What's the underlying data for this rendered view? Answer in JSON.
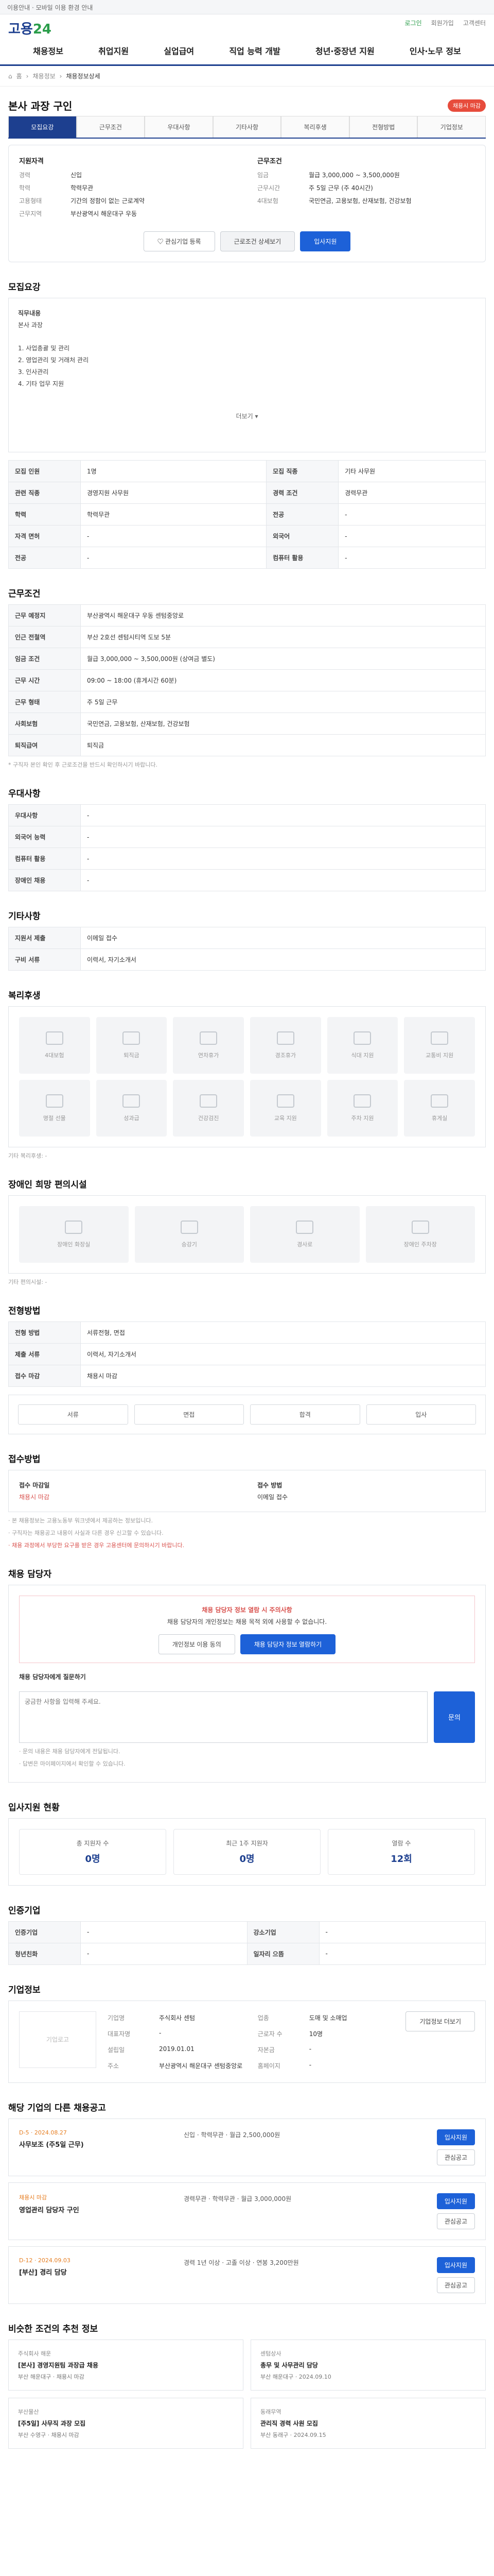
{
  "notice": "이용안내 · 모바일 이용 환경 안내",
  "top_links": [
    "로그인",
    "회원가입",
    "고객센터"
  ],
  "logo": {
    "main": "고용",
    "accent": "24"
  },
  "gnb": [
    "채용정보",
    "취업지원",
    "실업급여",
    "직업 능력 개발",
    "청년·중장년 지원",
    "인사·노무 정보"
  ],
  "breadcrumb": [
    "홈",
    "채용정보",
    "채용정보상세"
  ],
  "tabs": [
    "모집요강",
    "근무조건",
    "우대사항",
    "기타사항",
    "복리후생",
    "전형방법",
    "기업정보"
  ],
  "job": {
    "title": "본사 과장 구인",
    "deadline": "채용시 마감"
  },
  "summary": {
    "left_head": "지원자격",
    "left": [
      {
        "k": "경력",
        "v": "신입"
      },
      {
        "k": "학력",
        "v": "학력무관"
      },
      {
        "k": "고용형태",
        "v": "기간의 정함이 없는 근로계약"
      },
      {
        "k": "근무지역",
        "v": "부산광역시 해운대구 우동"
      }
    ],
    "right_head": "근무조건",
    "right": [
      {
        "k": "임금",
        "v": "월급 3,000,000 ~ 3,500,000원"
      },
      {
        "k": "근무시간",
        "v": "주 5일 근무 (주 40시간)"
      },
      {
        "k": "4대보험",
        "v": "국민연금, 고용보험, 산재보험, 건강보험"
      }
    ],
    "buttons": [
      "관심기업 등록",
      "근로조건 상세보기",
      "입사지원"
    ]
  },
  "sections": {
    "recruit": "모집요강",
    "work": "근무조건",
    "pref": "우대사항",
    "etc": "기타사항",
    "welfare": "복리후생",
    "disabled": "장애인 희망 편의시설",
    "selection": "전형방법",
    "apply_method": "접수방법",
    "manager": "채용 담당자",
    "stats": "입사지원 현황",
    "info": "인증기업",
    "company": "기업정보",
    "company_jobs": "해당 기업의 다른 채용공고",
    "recommend": "비슷한 조건의 추천 정보"
  },
  "recruit_desc": {
    "job_label": "직무내용",
    "job_value": "본사 과장",
    "items": [
      "1. 사업총괄 및 관리",
      "2. 영업관리 및 거래처 관리",
      "3. 인사관리",
      "4. 기타 업무 지원"
    ],
    "more": "더보기 ▾"
  },
  "recruit_table": [
    [
      "모집 인원",
      "1명",
      "모집 직종",
      "기타 사무원"
    ],
    [
      "관련 직종",
      "경영지원 사무원",
      "경력 조건",
      "경력무관"
    ],
    [
      "학력",
      "학력무관",
      "전공",
      "-"
    ],
    [
      "자격 면허",
      "-",
      "외국어",
      "-"
    ],
    [
      "전공",
      "-",
      "컴퓨터 활용",
      "-"
    ]
  ],
  "work_table": [
    [
      "근무 예정지",
      "부산광역시 해운대구 우동 센텀중앙로"
    ],
    [
      "인근 전철역",
      "부산 2호선 센텀시티역 도보 5분"
    ],
    [
      "임금 조건",
      "월급 3,000,000 ~ 3,500,000원 (상여금 별도)"
    ],
    [
      "근무 시간",
      "09:00 ~ 18:00 (휴게시간 60분)"
    ],
    [
      "근무 형태",
      "주 5일 근무"
    ],
    [
      "사회보험",
      "국민연금, 고용보험, 산재보험, 건강보험"
    ],
    [
      "퇴직급여",
      "퇴직금"
    ]
  ],
  "work_note": "* 구직자 본인 확인 후 근로조건을 반드시 확인하시기 바랍니다.",
  "pref_table": [
    [
      "우대사항",
      "-"
    ],
    [
      "외국어 능력",
      "-"
    ],
    [
      "컴퓨터 활용",
      "-"
    ],
    [
      "장애인 채용",
      "-"
    ]
  ],
  "etc_table": [
    [
      "지원서 제출",
      "이메일 접수"
    ],
    [
      "구비 서류",
      "이력서, 자기소개서"
    ]
  ],
  "welfare_items": [
    "4대보험",
    "퇴직금",
    "연차휴가",
    "경조휴가",
    "식대 지원",
    "교통비 지원",
    "명절 선물",
    "성과급",
    "건강검진",
    "교육 지원",
    "주차 지원",
    "휴게실"
  ],
  "welfare_note": "기타 복리후생: -",
  "disabled_items": [
    "장애인 화장실",
    "승강기",
    "경사로",
    "장애인 주차장"
  ],
  "disabled_note": "기타 편의시설: -",
  "selection_table": [
    [
      "전형 방법",
      "서류전형, 면접"
    ],
    [
      "제출 서류",
      "이력서, 자기소개서"
    ],
    [
      "접수 마감",
      "채용시 마감"
    ]
  ],
  "selection_chips": [
    "서류",
    "면접",
    "합격",
    "입사"
  ],
  "apply": {
    "left_head": "접수 마감일",
    "left_value": "채용시 마감",
    "right_head": "접수 방법",
    "right_value": "이메일 접수",
    "notes": [
      "· 본 채용정보는 고용노동부 워크넷에서 제공하는 정보입니다.",
      "· 구직자는 채용공고 내용이 사실과 다른 경우 신고할 수 있습니다.",
      "· 채용 과정에서 부당한 요구를 받은 경우 고용센터에 문의하시기 바랍니다."
    ]
  },
  "manager": {
    "alert_title": "채용 담당자 정보 열람 시 주의사항",
    "alert_body": "채용 담당자의 개인정보는 채용 목적 외에 사용할 수 없습니다.",
    "btns": [
      "개인정보 이용 동의",
      "채용 담당자 정보 열람하기"
    ],
    "q_label": "채용 담당자에게 질문하기",
    "q_placeholder": "궁금한 사항을 입력해 주세요.",
    "q_button": "문의",
    "notes": [
      "· 문의 내용은 채용 담당자에게 전달됩니다.",
      "· 답변은 마이페이지에서 확인할 수 있습니다."
    ]
  },
  "stats": [
    {
      "label": "총 지원자 수",
      "value": "0명"
    },
    {
      "label": "최근 1주 지원자",
      "value": "0명"
    },
    {
      "label": "열람 수",
      "value": "12회"
    }
  ],
  "cert_table": [
    [
      "인증기업",
      "-",
      "강소기업",
      "-"
    ],
    [
      "청년친화",
      "-",
      "일자리 으뜸",
      "-"
    ]
  ],
  "company": {
    "logo_alt": "기업로고",
    "fields": [
      {
        "k": "기업명",
        "v": "주식회사 센텀"
      },
      {
        "k": "업종",
        "v": "도매 및 소매업"
      },
      {
        "k": "대표자명",
        "v": "-"
      },
      {
        "k": "근로자 수",
        "v": "10명"
      },
      {
        "k": "설립일",
        "v": "2019.01.01"
      },
      {
        "k": "자본금",
        "v": "-"
      },
      {
        "k": "주소",
        "v": "부산광역시 해운대구 센텀중앙로"
      },
      {
        "k": "홈페이지",
        "v": "-"
      }
    ],
    "button": "기업정보 더보기"
  },
  "company_jobs": [
    {
      "date": "D-5 · 2024.08.27",
      "title": "사무보조 (주5일 근무)",
      "meta": "신입 · 학력무관 · 월급 2,500,000원",
      "btns": [
        "입사지원",
        "관심공고"
      ]
    },
    {
      "date": "채용시 마감",
      "title": "영업관리 담당자 구인",
      "meta": "경력무관 · 학력무관 · 월급 3,000,000원",
      "btns": [
        "입사지원",
        "관심공고"
      ]
    },
    {
      "date": "D-12 · 2024.09.03",
      "title": "[부산] 경리 담당",
      "meta": "경력 1년 이상 · 고졸 이상 · 연봉 3,200만원",
      "btns": [
        "입사지원",
        "관심공고"
      ]
    }
  ],
  "recommend": [
    {
      "co": "주식회사 해운",
      "title": "[본사] 경영지원팀 과장급 채용",
      "meta": "부산 해운대구 · 채용시 마감"
    },
    {
      "co": "센텀상사",
      "title": "총무 및 사무관리 담당",
      "meta": "부산 해운대구 · 2024.09.10"
    },
    {
      "co": "부산물산",
      "title": "[주5일] 사무직 과장 모집",
      "meta": "부산 수영구 · 채용시 마감"
    },
    {
      "co": "동래무역",
      "title": "관리직 경력 사원 모집",
      "meta": "부산 동래구 · 2024.09.15"
    }
  ]
}
